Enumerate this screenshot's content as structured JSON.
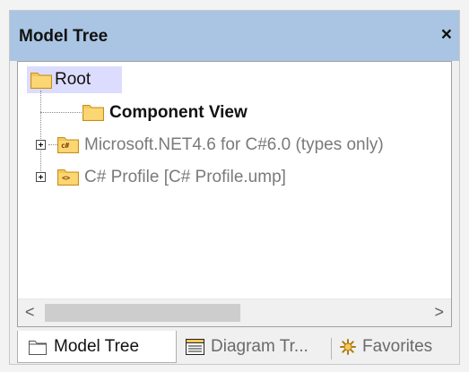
{
  "panel": {
    "title": "Model Tree",
    "close_label": "×"
  },
  "tree": {
    "nodes": [
      {
        "label": "Root",
        "type": "folder",
        "selected": true
      },
      {
        "label": "Component View",
        "type": "folder"
      },
      {
        "label": "Microsoft.NET4.6 for C#6.0 (types only)",
        "type": "package-csharp",
        "badge": "c#"
      },
      {
        "label": "C# Profile [C# Profile.ump]",
        "type": "package-profile",
        "badge": "<>"
      }
    ]
  },
  "scrollbar": {
    "left_arrow": "<",
    "right_arrow": ">"
  },
  "tabs": [
    {
      "label": "Model Tree",
      "icon": "folder-icon",
      "active": true
    },
    {
      "label": "Diagram Tr...",
      "icon": "diagram-tree-icon",
      "active": false
    },
    {
      "label": "Favorites",
      "icon": "favorites-icon",
      "active": false
    }
  ],
  "colors": {
    "title_bar": "#a9c5e3",
    "selection": "#dcdcff",
    "folder": "#f5c65a",
    "dimmed_text": "#7a7a7a"
  }
}
